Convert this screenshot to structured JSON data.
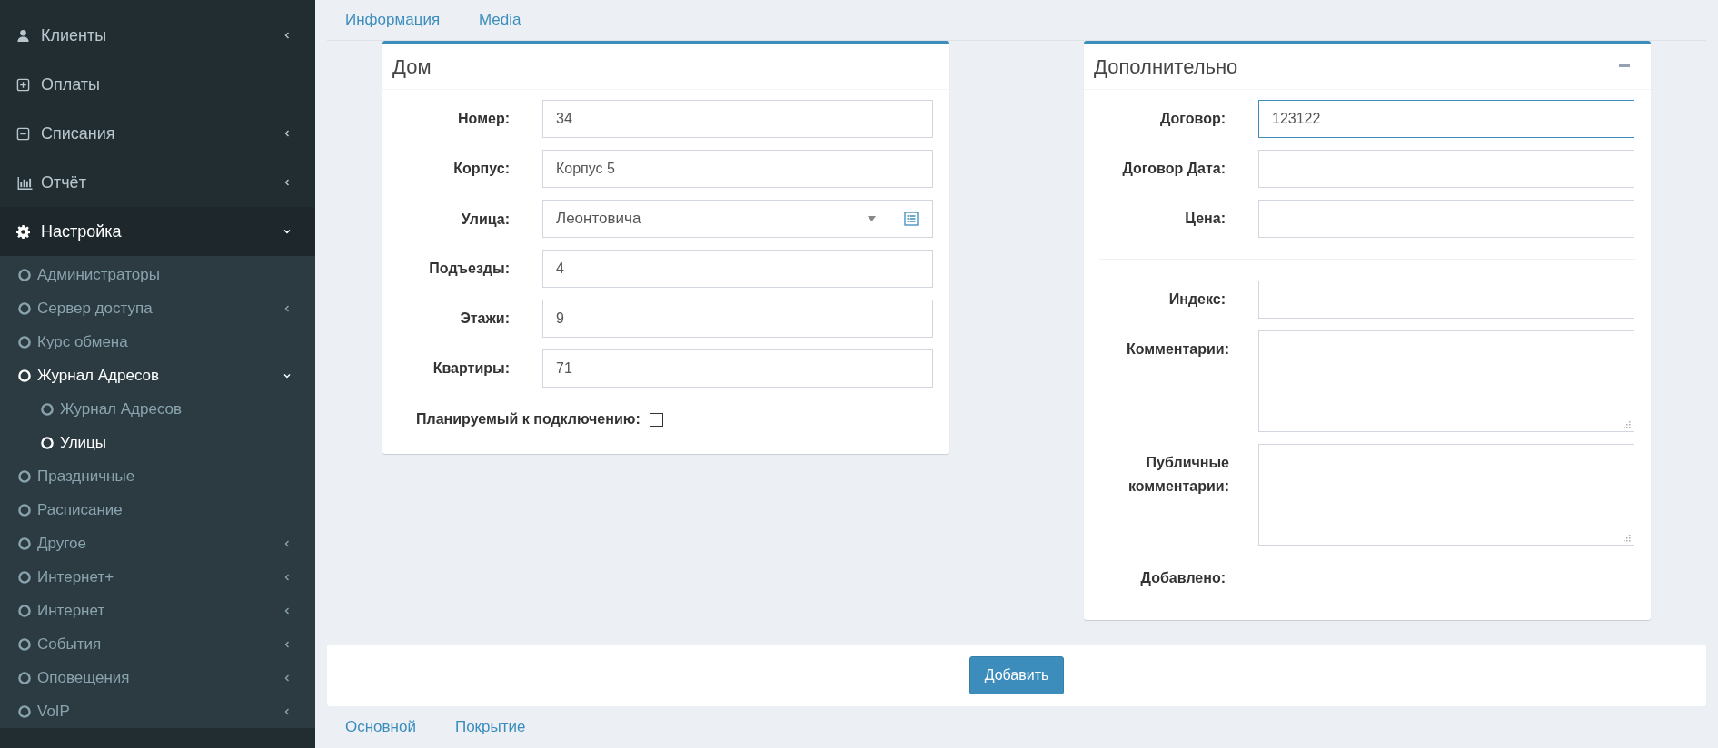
{
  "sidebar": {
    "items": [
      {
        "label": "Клиенты",
        "expanded": false,
        "selected": false
      },
      {
        "label": "Оплаты",
        "selected": false
      },
      {
        "label": "Списания",
        "expanded": false,
        "selected": false
      },
      {
        "label": "Отчёт",
        "expanded": false,
        "selected": false
      },
      {
        "label": "Настройка",
        "expanded": true,
        "selected": true,
        "children": [
          {
            "label": "Администраторы",
            "selected": false
          },
          {
            "label": "Сервер доступа",
            "expanded": false,
            "selected": false
          },
          {
            "label": "Курс обмена",
            "selected": false
          },
          {
            "label": "Журнал Адресов",
            "expanded": true,
            "selected": true,
            "children": [
              {
                "label": "Журнал Адресов",
                "selected": false
              },
              {
                "label": "Улицы",
                "selected": true
              }
            ]
          },
          {
            "label": "Праздничные",
            "selected": false
          },
          {
            "label": "Расписание",
            "selected": false
          },
          {
            "label": "Другое",
            "expanded": false,
            "selected": false
          },
          {
            "label": "Интернет+",
            "expanded": false,
            "selected": false
          },
          {
            "label": "Интернет",
            "expanded": false,
            "selected": false
          },
          {
            "label": "События",
            "expanded": false,
            "selected": false
          },
          {
            "label": "Оповещения",
            "expanded": false,
            "selected": false
          },
          {
            "label": "VoIP",
            "expanded": false,
            "selected": false
          }
        ]
      }
    ]
  },
  "top_tabs": [
    {
      "label": "Информация"
    },
    {
      "label": "Media"
    }
  ],
  "house_panel": {
    "title": "Дом",
    "fields": [
      {
        "kind": "text",
        "label": "Номер:",
        "value": "34"
      },
      {
        "kind": "text",
        "label": "Корпус:",
        "value": "Корпус 5"
      },
      {
        "kind": "select",
        "label": "Улица:",
        "value": "Леонтовича"
      },
      {
        "kind": "text",
        "label": "Подъезды:",
        "value": "4"
      },
      {
        "kind": "text",
        "label": "Этажи:",
        "value": "9"
      },
      {
        "kind": "text",
        "label": "Квартиры:",
        "value": "71"
      },
      {
        "kind": "checkbox",
        "label": "Планируемый к подключению:",
        "checked": false
      }
    ]
  },
  "extra_panel": {
    "title": "Дополнительно",
    "fields": [
      {
        "kind": "text",
        "label": "Договор:",
        "value": "123122",
        "focused": true
      },
      {
        "kind": "text",
        "label": "Договор Дата:",
        "focused": false
      },
      {
        "kind": "text",
        "label": "Цена:",
        "focused": false
      },
      {
        "kind": "divider"
      },
      {
        "kind": "text",
        "label": "Индекс:",
        "focused": false
      },
      {
        "kind": "textarea",
        "label": "Комментарии:"
      },
      {
        "kind": "textarea",
        "label": "Публичные комментарии:"
      },
      {
        "kind": "static",
        "label": "Добавлено:"
      }
    ]
  },
  "submit_button": "Добавить",
  "bottom_tabs": [
    {
      "label": "Основной"
    },
    {
      "label": "Покрытие"
    }
  ]
}
